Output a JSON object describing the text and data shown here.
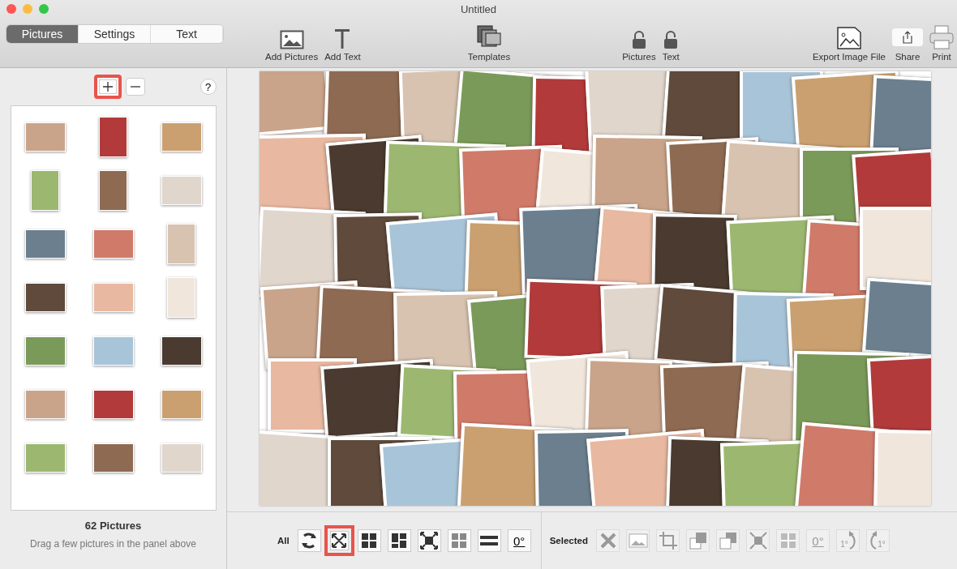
{
  "window": {
    "title": "Untitled"
  },
  "tabs": [
    {
      "label": "Pictures",
      "selected": true
    },
    {
      "label": "Settings",
      "selected": false
    },
    {
      "label": "Text",
      "selected": false
    }
  ],
  "toolbar": {
    "insert": [
      {
        "kind": "add-pictures",
        "label": "Add Pictures"
      },
      {
        "kind": "add-text",
        "label": "Add Text"
      }
    ],
    "templates": [
      {
        "kind": "templates",
        "label": "Templates"
      }
    ],
    "locks": [
      {
        "kind": "lock",
        "label": "Pictures",
        "locked": false
      },
      {
        "kind": "lock",
        "label": "Text",
        "locked": false
      }
    ],
    "output": [
      {
        "kind": "export",
        "label": "Export Image File"
      },
      {
        "kind": "share",
        "label": "Share"
      },
      {
        "kind": "print",
        "label": "Print"
      }
    ]
  },
  "panel": {
    "buttons": [
      {
        "kind": "add",
        "highlighted": true
      },
      {
        "kind": "remove",
        "highlighted": false
      }
    ],
    "help": "?",
    "count": "62 Pictures",
    "hint": "Drag a few pictures in the panel above"
  },
  "all_tools": {
    "label": "All",
    "tools": [
      {
        "kind": "shuffle",
        "highlighted": false
      },
      {
        "kind": "fit",
        "highlighted": true
      },
      {
        "kind": "grid",
        "highlighted": false
      },
      {
        "kind": "mosaic",
        "highlighted": false
      },
      {
        "kind": "expand",
        "highlighted": false
      },
      {
        "kind": "shrink",
        "highlighted": false
      },
      {
        "kind": "equal",
        "highlighted": false
      },
      {
        "kind": "rotate-zero",
        "text": "0°",
        "highlighted": false
      }
    ]
  },
  "selected_tools": {
    "label": "Selected",
    "tools": [
      {
        "kind": "delete",
        "disabled": true
      },
      {
        "kind": "image",
        "disabled": true
      },
      {
        "kind": "crop",
        "disabled": true
      },
      {
        "kind": "bring-front",
        "disabled": true
      },
      {
        "kind": "send-back",
        "disabled": true
      },
      {
        "kind": "expand",
        "disabled": true
      },
      {
        "kind": "shrink",
        "disabled": true
      },
      {
        "kind": "rotate-zero",
        "text": "0°",
        "disabled": true
      },
      {
        "kind": "rotate-right",
        "text": "1°",
        "disabled": true
      },
      {
        "kind": "rotate-left",
        "text": "1°",
        "disabled": true
      }
    ]
  }
}
